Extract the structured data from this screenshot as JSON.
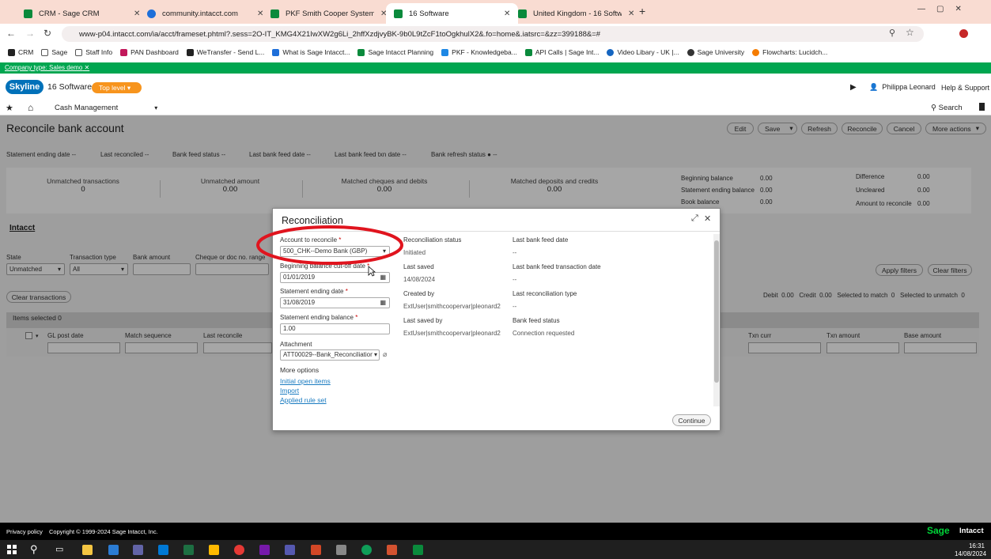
{
  "browser": {
    "tabs": [
      {
        "label": "CRM - Sage CRM",
        "color": "#0a8a3c"
      },
      {
        "label": "community.intacct.com",
        "color": "#1e6fd9"
      },
      {
        "label": "PKF Smith Cooper Systems",
        "color": "#0a8a3c"
      },
      {
        "label": "16 Software",
        "color": "#0a8a3c"
      },
      {
        "label": "United Kingdom - 16 Software",
        "color": "#0a8a3c"
      }
    ],
    "url": "www-p04.intacct.com/ia/acct/frameset.phtml?.sess=2O-IT_KMG4X21IwXW2g6Li_2hffXzdjvyBK-9b0L9tZcF1toOgkhulX2&.fo=home&.iatsrc=&zz=399188&=#",
    "bookmarks": [
      "CRM",
      "Sage",
      "Staff Info",
      "PAN Dashboard",
      "WeTransfer - Send L...",
      "What is Sage Intacct...",
      "Sage Intacct Planning",
      "PKF - Knowledgeba...",
      "API Calls | Sage Int...",
      "Video Libary - UK |...",
      "Sage University",
      "Flowcharts: Lucidch..."
    ]
  },
  "company_bar": "Company type: Sales demo",
  "header": {
    "logo": "Skyline",
    "company": "16 Software",
    "level": "Top level",
    "user": "Philippa Leonard",
    "help": "Help & Support"
  },
  "nav": {
    "module": "Cash Management",
    "search": "Search"
  },
  "page": {
    "title": "Reconcile bank account",
    "buttons": [
      "Edit",
      "Save",
      "Refresh",
      "Reconcile",
      "Cancel",
      "More actions"
    ],
    "header_labels": [
      "Statement ending date",
      "Last reconciled",
      "Bank feed status",
      "Last bank feed date",
      "Last bank feed txn date",
      "Bank refresh status"
    ],
    "header_dash": "--",
    "stats": [
      {
        "label": "Unmatched transactions",
        "value": "0"
      },
      {
        "label": "Unmatched amount",
        "value": "0.00"
      },
      {
        "label": "Matched cheques and debits",
        "value": "0.00"
      },
      {
        "label": "Matched deposits and credits",
        "value": "0.00"
      }
    ],
    "balances": [
      {
        "label": "Beginning balance",
        "value": "0.00"
      },
      {
        "label": "Statement ending balance",
        "value": "0.00"
      },
      {
        "label": "Book balance",
        "value": "0.00"
      }
    ],
    "diffs": [
      {
        "label": "Difference",
        "value": "0.00"
      },
      {
        "label": "Uncleared",
        "value": "0.00"
      },
      {
        "label": "Amount to reconcile",
        "value": "0.00"
      }
    ],
    "section": "Intacct",
    "filters": {
      "state_label": "State",
      "state_value": "Unmatched",
      "type_label": "Transaction type",
      "type_value": "All",
      "amount_label": "Bank amount",
      "cheque_label": "Cheque or doc no. range"
    },
    "apply_filters": "Apply filters",
    "clear_filters": "Clear filters",
    "clear_transactions": "Clear transactions",
    "summary": "Debit  0.00   Credit  0.00   Selected to match  0   Selected to unmatch  0",
    "items_selected": "Items selected 0",
    "columns_left": [
      "GL post date",
      "Match sequence",
      "Last reconcile"
    ],
    "columns_right": [
      "Txn curr",
      "Txn amount",
      "Base amount"
    ]
  },
  "modal": {
    "title": "Reconciliation",
    "account_label": "Account to reconcile",
    "account_value": "500_CHK--Demo Bank (GBP)",
    "cutoff_label": "Beginning balance cut-off date",
    "cutoff_value": "01/01/2019",
    "end_date_label": "Statement ending date",
    "end_date_value": "31/08/2019",
    "end_balance_label": "Statement ending balance",
    "end_balance_value": "1.00",
    "attachment_label": "Attachment",
    "attachment_value": "ATT00029--Bank_Reconciliation",
    "more_options": "More options",
    "links": [
      "Initial open items",
      "Import",
      "Applied rule set"
    ],
    "status_label": "Reconciliation status",
    "status_value": "Initiated",
    "saved_label": "Last saved",
    "saved_value": "14/08/2024",
    "created_label": "Created by",
    "created_value": "ExtUser|smithcoopervar|pleonard2",
    "savedby_label": "Last saved by",
    "savedby_value": "ExtUser|smithcoopervar|pleonard2",
    "feed_date_label": "Last bank feed date",
    "feed_date_value": "--",
    "feed_txn_label": "Last bank feed transaction date",
    "feed_txn_value": "--",
    "rec_type_label": "Last reconciliation type",
    "rec_type_value": "--",
    "feed_status_label": "Bank feed status",
    "feed_status_value": "Connection requested",
    "continue": "Continue"
  },
  "footer": {
    "privacy": "Privacy policy",
    "copyright": "Copyright © 1999-2024 Sage Intacct, Inc.",
    "brand1": "Sage",
    "brand2": "Intacct"
  },
  "taskbar": {
    "time": "16:31",
    "date": "14/08/2024"
  },
  "colors": {
    "accent_green": "#00a650",
    "orange": "#f7941d",
    "blue_logo": "#0071b9",
    "annotation_red": "#e0141e"
  }
}
